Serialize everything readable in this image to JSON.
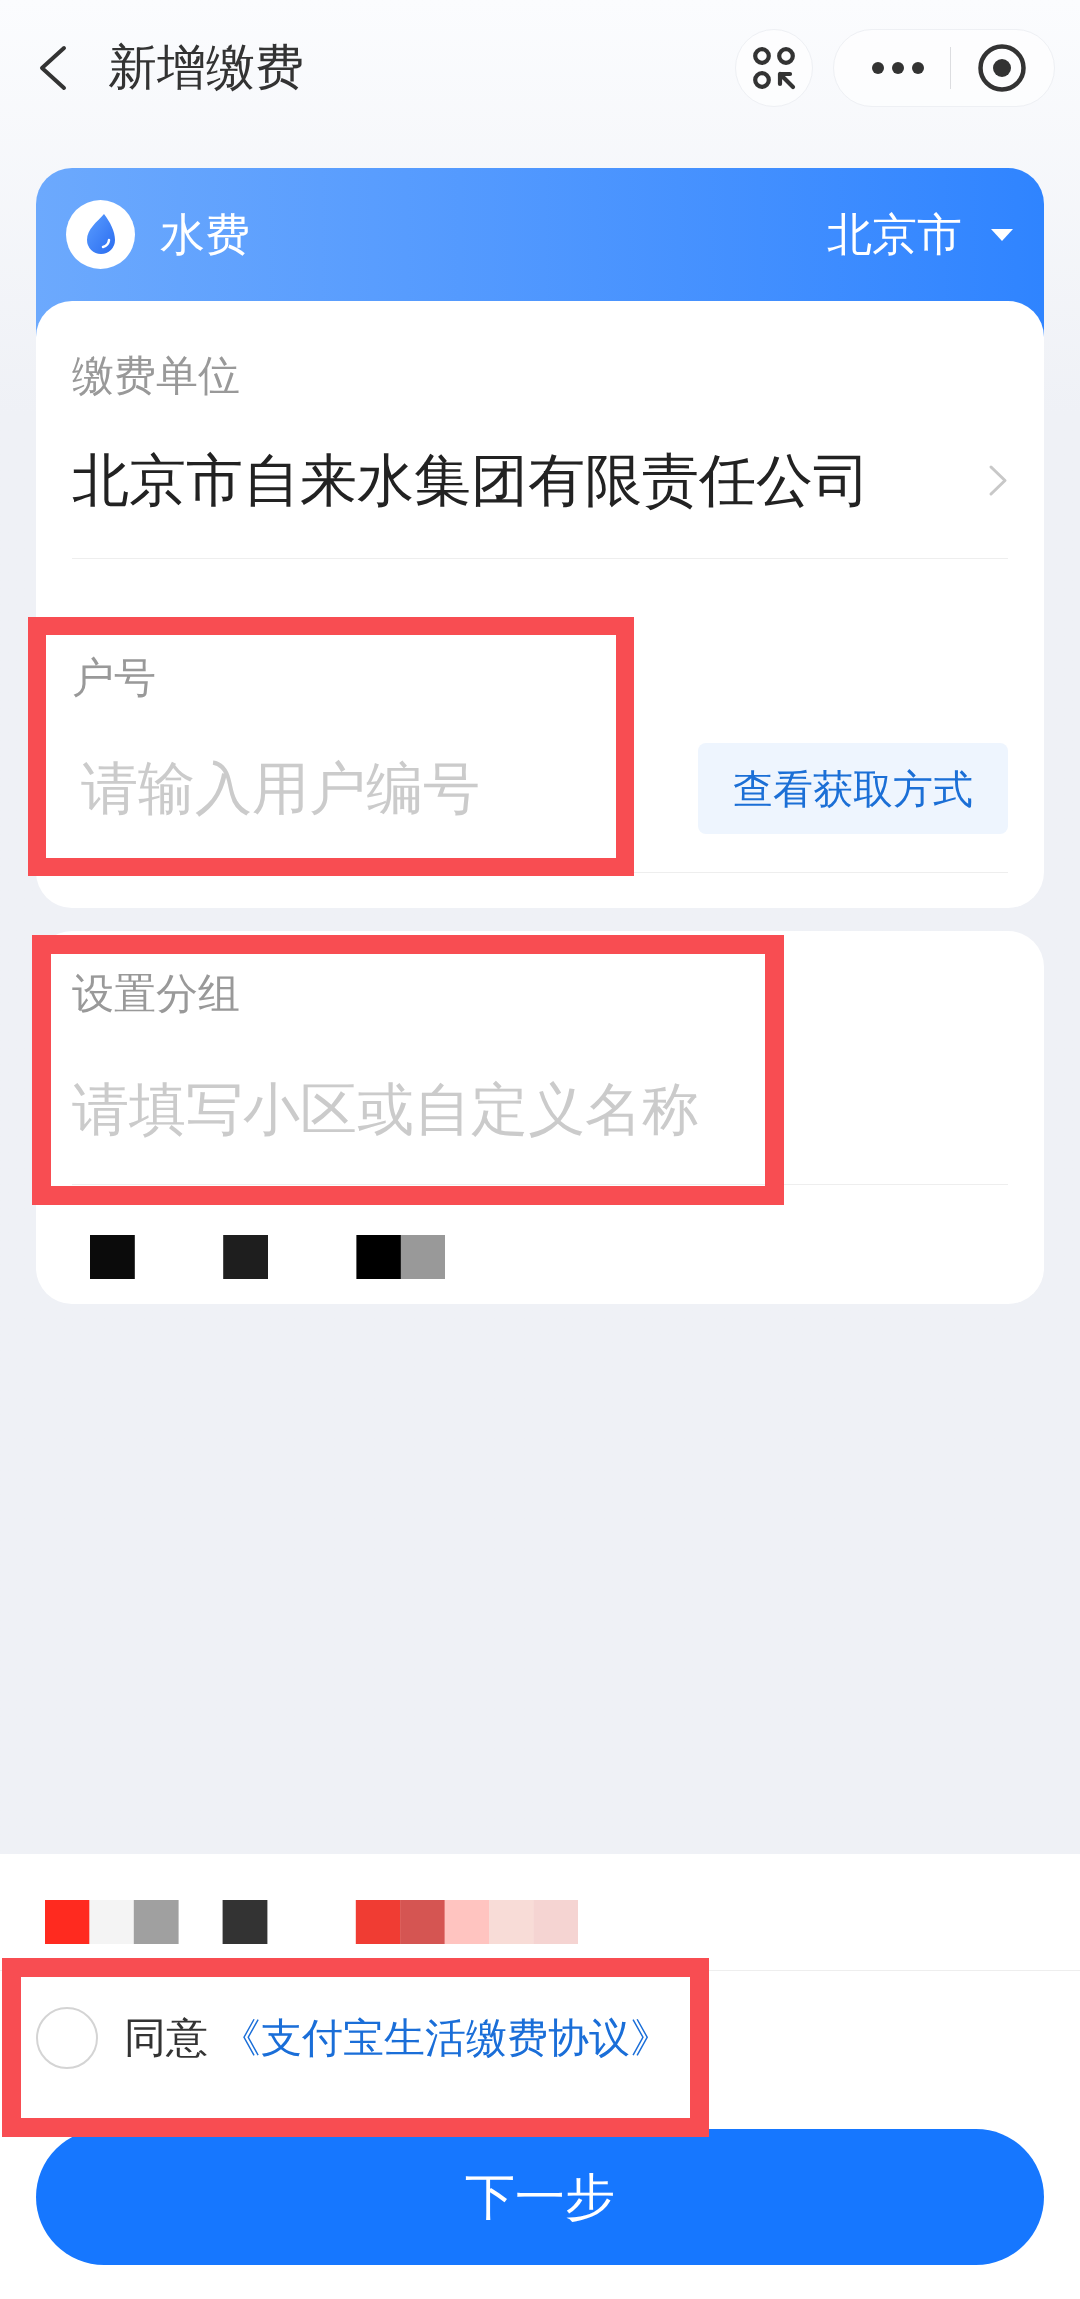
{
  "nav_bar": {
    "title": "新增缴费"
  },
  "bill_card": {
    "category": "水费",
    "city": "北京市",
    "payee": {
      "label": "缴费单位",
      "value": "北京市自来水集团有限责任公司"
    },
    "account": {
      "label": "户号",
      "placeholder": "请输入用户编号",
      "help_button": "查看获取方式",
      "highlighted": true
    }
  },
  "group": {
    "label": "设置分组",
    "placeholder": "请填写小区或自定义名称",
    "highlighted": true,
    "redacted_line": true
  },
  "notice": {
    "redacted": true
  },
  "agreement": {
    "checked": false,
    "prefix": "同意",
    "link": "《支付宝生活缴费协议》",
    "highlighted": true
  },
  "next_button": "下一步"
}
